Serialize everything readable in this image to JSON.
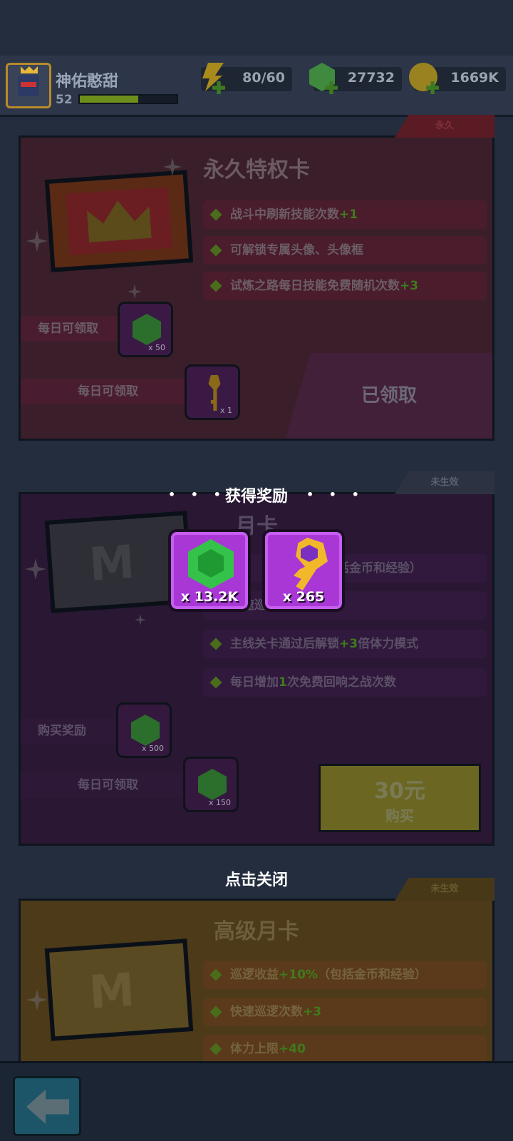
{
  "player": {
    "name": "神佑憨甜",
    "level": "52",
    "xp_fraction": 0.6
  },
  "resources": {
    "energy": "80/60",
    "gems": "27732",
    "gold": "1669K"
  },
  "card1": {
    "tag": "永久",
    "title": "永久特权卡",
    "features": [
      {
        "text": "战斗中刷新技能次数",
        "highlight": "+1"
      },
      {
        "text": "可解锁专属头像、头像框",
        "highlight": ""
      },
      {
        "text": "试炼之路每日技能免费随机次数",
        "highlight": "+3"
      }
    ],
    "rewards": [
      {
        "label": "每日可领取",
        "qty": "x 50"
      },
      {
        "label": "每日可领取",
        "qty": "x 1"
      }
    ],
    "status": "已领取"
  },
  "card2": {
    "tag": "未生效",
    "title": "月卡",
    "features": [
      {
        "pre": "",
        "highlight": "",
        "text": "括金币和经验）"
      },
      {
        "pre": "快速巡逻次数",
        "highlight": "+1",
        "text": ""
      },
      {
        "pre": "主线关卡通过后解锁",
        "highlight": "+3",
        "text": "倍体力模式"
      },
      {
        "pre": "每日增加",
        "highlight": "1",
        "text": "次免费回响之战次数"
      }
    ],
    "rewards": [
      {
        "label": "购买奖励",
        "qty": "x 500"
      },
      {
        "label": "每日可领取",
        "qty": "x 150"
      }
    ],
    "price": "30元",
    "buy_label": "购买"
  },
  "card3": {
    "tag": "未生效",
    "title": "高级月卡",
    "features": [
      {
        "pre": "巡逻收益",
        "highlight": "+10%",
        "text": "（包括金币和经验）"
      },
      {
        "pre": "快速巡逻次数",
        "highlight": "+3",
        "text": ""
      },
      {
        "pre": "体力上限",
        "highlight": "+40",
        "text": ""
      }
    ]
  },
  "overlay": {
    "title": "获得奖励",
    "dots": "• • •",
    "rewards": [
      {
        "icon": "gem-icon",
        "qty": "x 13.2K"
      },
      {
        "icon": "key-icon",
        "qty": "x 265"
      }
    ],
    "close_hint": "点击关闭"
  },
  "letters": {
    "mcard": "M"
  }
}
